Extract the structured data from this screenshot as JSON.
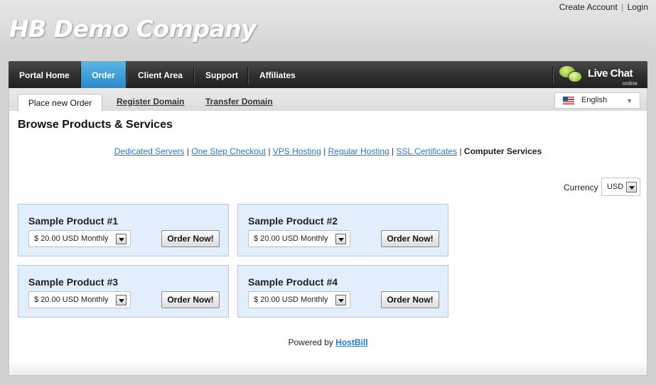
{
  "header": {
    "top_links": {
      "create_account": "Create Account",
      "separator": "|",
      "login": "Login"
    },
    "company_name": "HB Demo Company"
  },
  "nav": {
    "items": [
      {
        "label": "Portal Home"
      },
      {
        "label": "Order",
        "active": true
      },
      {
        "label": "Client Area"
      },
      {
        "label": "Support"
      },
      {
        "label": "Affiliates"
      }
    ],
    "live_chat": {
      "title": "Live Chat",
      "status": "online"
    }
  },
  "subnav": {
    "tabs": [
      {
        "label": "Place new Order",
        "active": true
      },
      {
        "label": "Register Domain"
      },
      {
        "label": "Transfer Domain"
      }
    ],
    "language": {
      "selected": "English",
      "flag": "us-flag-icon"
    }
  },
  "page": {
    "title": "Browse Products & Services",
    "categories": [
      "Dedicated Servers",
      "One Step Checkout",
      "VPS Hosting",
      "Regular Hosting",
      "SSL Certificates"
    ],
    "current_category": "Computer Services",
    "category_separator": "|",
    "currency": {
      "label": "Currency",
      "selected": "USD"
    }
  },
  "products": [
    {
      "name": "Sample Product #1",
      "price": "$ 20.00 USD Monthly",
      "button": "Order Now!"
    },
    {
      "name": "Sample Product #2",
      "price": "$ 20.00 USD Monthly",
      "button": "Order Now!"
    },
    {
      "name": "Sample Product #3",
      "price": "$ 20.00 USD Monthly",
      "button": "Order Now!"
    },
    {
      "name": "Sample Product #4",
      "price": "$ 20.00 USD Monthly",
      "button": "Order Now!"
    }
  ],
  "footer": {
    "powered_by": "Powered by",
    "brand": "HostBill"
  },
  "colors": {
    "accent": "#2a8bc9",
    "link": "#2a78bd",
    "product_bg": "#e3eefc",
    "nav_bg": "#2e2e2e"
  }
}
